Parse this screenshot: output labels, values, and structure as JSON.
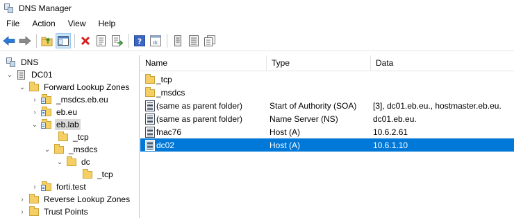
{
  "window": {
    "title": "DNS Manager"
  },
  "menu": [
    "File",
    "Action",
    "View",
    "Help"
  ],
  "toolbar": {
    "buttons": [
      "back-arrow-icon",
      "forward-arrow-icon",
      "up-folder-icon",
      "show-hide-console-tree-icon",
      "delete-icon",
      "properties-icon",
      "export-list-icon",
      "help-icon",
      "dc-icon",
      "server-icon",
      "list-icon",
      "records-icon"
    ]
  },
  "tree": {
    "items": [
      {
        "label": "DNS",
        "icon": "dns-icon",
        "expander": "",
        "level": 0
      },
      {
        "label": "DC01",
        "icon": "server-icon",
        "expander": "expanded",
        "level": 0
      },
      {
        "label": "Forward Lookup Zones",
        "icon": "folder-icon",
        "expander": "expanded",
        "level": 1
      },
      {
        "label": "_msdcs.eb.eu",
        "icon": "zone-icon",
        "expander": "collapsed",
        "level": 2
      },
      {
        "label": "eb.eu",
        "icon": "zone-icon",
        "expander": "collapsed",
        "level": 2
      },
      {
        "label": "eb.lab",
        "icon": "zone-icon",
        "expander": "expanded",
        "level": 2,
        "selected": true
      },
      {
        "label": "_tcp",
        "icon": "folder-icon",
        "expander": "",
        "level": 3
      },
      {
        "label": "_msdcs",
        "icon": "folder-icon",
        "expander": "expanded",
        "level": 3
      },
      {
        "label": "dc",
        "icon": "folder-icon",
        "expander": "expanded",
        "level": 4
      },
      {
        "label": "_tcp",
        "icon": "folder-icon",
        "expander": "",
        "level": 5
      },
      {
        "label": "forti.test",
        "icon": "zone-icon",
        "expander": "collapsed",
        "level": 2
      },
      {
        "label": "Reverse Lookup Zones",
        "icon": "folder-icon",
        "expander": "collapsed",
        "level": 1
      },
      {
        "label": "Trust Points",
        "icon": "folder-icon",
        "expander": "collapsed",
        "level": 1
      }
    ]
  },
  "list": {
    "columns": [
      "Name",
      "Type",
      "Data"
    ],
    "rows": [
      {
        "name": "_tcp",
        "type": "",
        "data": "",
        "icon": "folder-icon"
      },
      {
        "name": "_msdcs",
        "type": "",
        "data": "",
        "icon": "folder-icon"
      },
      {
        "name": "(same as parent folder)",
        "type": "Start of Authority (SOA)",
        "data": "[3], dc01.eb.eu., hostmaster.eb.eu.",
        "icon": "record-icon"
      },
      {
        "name": "(same as parent folder)",
        "type": "Name Server (NS)",
        "data": "dc01.eb.eu.",
        "icon": "record-icon"
      },
      {
        "name": "fnac76",
        "type": "Host (A)",
        "data": "10.6.2.61",
        "icon": "record-icon"
      },
      {
        "name": "dc02",
        "type": "Host (A)",
        "data": "10.6.1.10",
        "icon": "record-icon",
        "selected": true
      }
    ]
  }
}
